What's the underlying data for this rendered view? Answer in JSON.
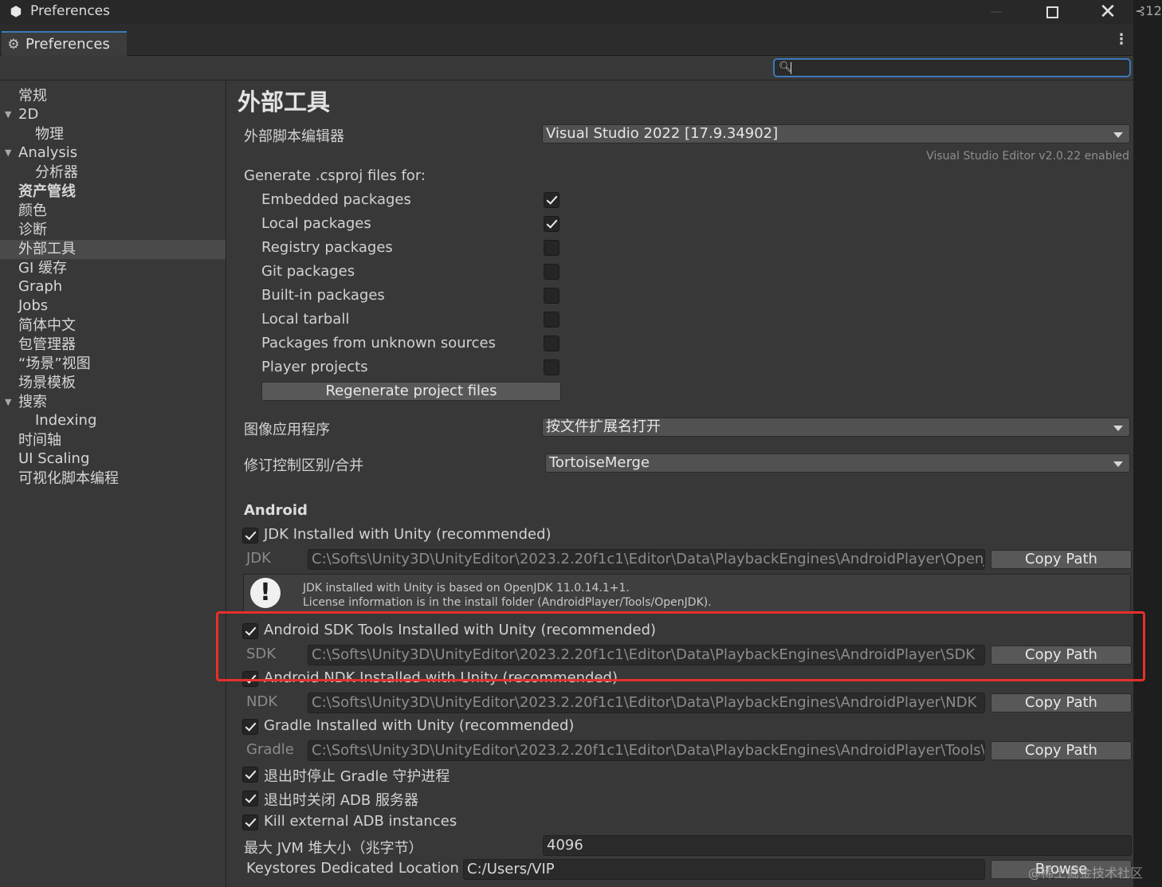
{
  "window": {
    "title": "Preferences",
    "side_chip": "⊰12"
  },
  "tab": {
    "label": "Preferences"
  },
  "sidebar": {
    "items": [
      {
        "label": "常规"
      },
      {
        "label": "2D"
      },
      {
        "label": "物理"
      },
      {
        "label": "Analysis"
      },
      {
        "label": "分析器"
      },
      {
        "label": "资产管线"
      },
      {
        "label": "颜色"
      },
      {
        "label": "诊断"
      },
      {
        "label": "外部工具"
      },
      {
        "label": "GI 缓存"
      },
      {
        "label": "Graph"
      },
      {
        "label": "Jobs"
      },
      {
        "label": "简体中文"
      },
      {
        "label": "包管理器"
      },
      {
        "label": "“场景”视图"
      },
      {
        "label": "场景模板"
      },
      {
        "label": "搜索"
      },
      {
        "label": "Indexing"
      },
      {
        "label": "时间轴"
      },
      {
        "label": "UI Scaling"
      },
      {
        "label": "可视化脚本编程"
      }
    ]
  },
  "main": {
    "title": "外部工具",
    "script_editor_label": "外部脚本编辑器",
    "script_editor_value": "Visual Studio 2022 [17.9.34902]",
    "editor_note": "Visual Studio Editor v2.0.22 enabled",
    "csproj_label": "Generate .csproj files for:",
    "csproj_options": [
      {
        "label": "Embedded packages",
        "checked": true
      },
      {
        "label": "Local packages",
        "checked": true
      },
      {
        "label": "Registry packages",
        "checked": false
      },
      {
        "label": "Git packages",
        "checked": false
      },
      {
        "label": "Built-in packages",
        "checked": false
      },
      {
        "label": "Local tarball",
        "checked": false
      },
      {
        "label": "Packages from unknown sources",
        "checked": false
      },
      {
        "label": "Player projects",
        "checked": false
      }
    ],
    "regenerate_label": "Regenerate project files",
    "image_app_label": "图像应用程序",
    "image_app_value": "按文件扩展名打开",
    "revision_label": "修订控制区别/合并",
    "revision_value": "TortoiseMerge"
  },
  "android": {
    "heading": "Android",
    "jdk_check_label": "JDK Installed with Unity (recommended)",
    "jdk_label": "JDK",
    "jdk_path": "C:\\Softs\\Unity3D\\UnityEditor\\2023.2.20f1c1\\Editor\\Data\\PlaybackEngines\\AndroidPlayer\\OpenJDK",
    "info_line1": "JDK installed with Unity is based on OpenJDK 11.0.14.1+1.",
    "info_line2": "License information is in the install folder (AndroidPlayer/Tools/OpenJDK).",
    "sdk_check_label": "Android SDK Tools Installed with Unity (recommended)",
    "sdk_label": "SDK",
    "sdk_path": "C:\\Softs\\Unity3D\\UnityEditor\\2023.2.20f1c1\\Editor\\Data\\PlaybackEngines\\AndroidPlayer\\SDK",
    "ndk_check_label": "Android NDK Installed with Unity (recommended)",
    "ndk_label": "NDK",
    "ndk_path": "C:\\Softs\\Unity3D\\UnityEditor\\2023.2.20f1c1\\Editor\\Data\\PlaybackEngines\\AndroidPlayer\\NDK",
    "gradle_check_label": "Gradle Installed with Unity (recommended)",
    "gradle_label": "Gradle",
    "gradle_path": "C:\\Softs\\Unity3D\\UnityEditor\\2023.2.20f1c1\\Editor\\Data\\PlaybackEngines\\AndroidPlayer\\Tools\\gradle",
    "copy_path": "Copy Path",
    "stop_gradle_label": "退出时停止 Gradle 守护进程",
    "close_adb_label": "退出时关闭 ADB 服务器",
    "kill_adb_label": "Kill external ADB instances",
    "jvm_label": "最大 JVM 堆大小（兆字节）",
    "jvm_value": "4096",
    "keystore_label": "Keystores Dedicated Location",
    "keystore_value": "C:/Users/VIP",
    "browse_label": "Browse"
  },
  "watermark": "@稀土掘金技术社区",
  "colors": {
    "accent": "#3a79bb",
    "highlight": "#e6302a",
    "background": "#383838"
  }
}
